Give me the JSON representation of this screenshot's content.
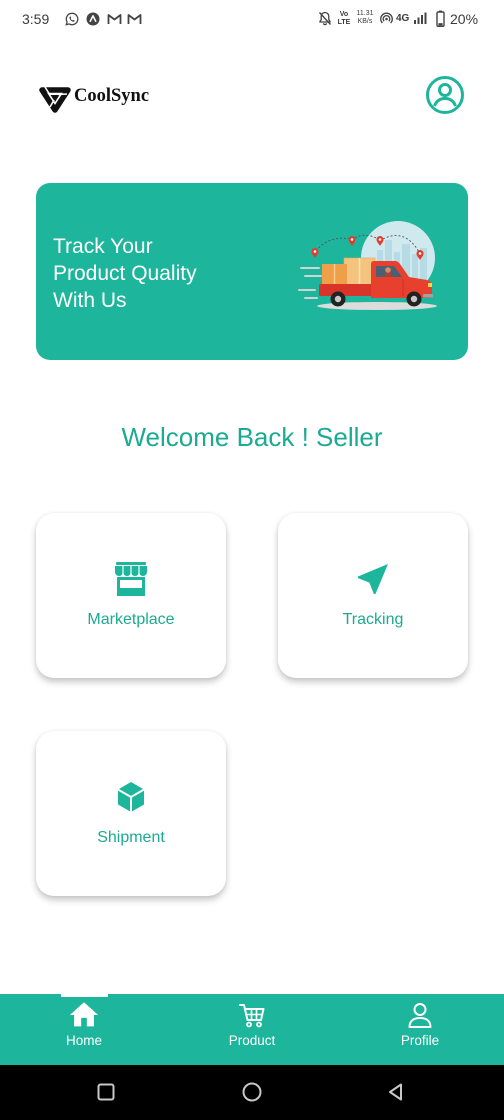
{
  "status_bar": {
    "time": "3:59",
    "left_icons": [
      "whatsapp-icon",
      "app-notification-icon",
      "gmail-icon",
      "gmail-icon"
    ],
    "volte_top": "Vo",
    "volte_bottom": "LTE",
    "speed_value": "11.31",
    "speed_unit": "KB/s",
    "network_type": "4G",
    "battery_percent": "20%",
    "battery_level": 0.2,
    "right_icons": [
      "bell-off-icon",
      "hotspot-icon",
      "signal-icon",
      "battery-icon"
    ]
  },
  "header": {
    "brand_name": "CoolSync",
    "logo_icon": "coolsync-logo",
    "profile_icon": "account-circle-icon"
  },
  "banner": {
    "lines": [
      "Track Your",
      "Product Quality",
      "With Us"
    ],
    "illustration": "delivery-truck-illustration"
  },
  "welcome_message": "Welcome Back ! Seller",
  "cards": [
    {
      "label": "Marketplace",
      "icon": "store-icon"
    },
    {
      "label": "Tracking",
      "icon": "navigation-arrow-icon"
    },
    {
      "label": "Shipment",
      "icon": "cube-icon"
    }
  ],
  "bottom_nav": {
    "items": [
      {
        "label": "Home",
        "icon": "home-icon",
        "active": true
      },
      {
        "label": "Product",
        "icon": "cart-icon",
        "active": false
      },
      {
        "label": "Profile",
        "icon": "person-icon",
        "active": false
      }
    ]
  },
  "system_nav": {
    "buttons": [
      "recents-icon",
      "home-circle-icon",
      "back-icon"
    ]
  },
  "colors": {
    "accent": "#1DB59B",
    "accent_text": "#1BAA92",
    "banner_text": "#FFFFFF",
    "system_nav_bg": "#000000"
  }
}
